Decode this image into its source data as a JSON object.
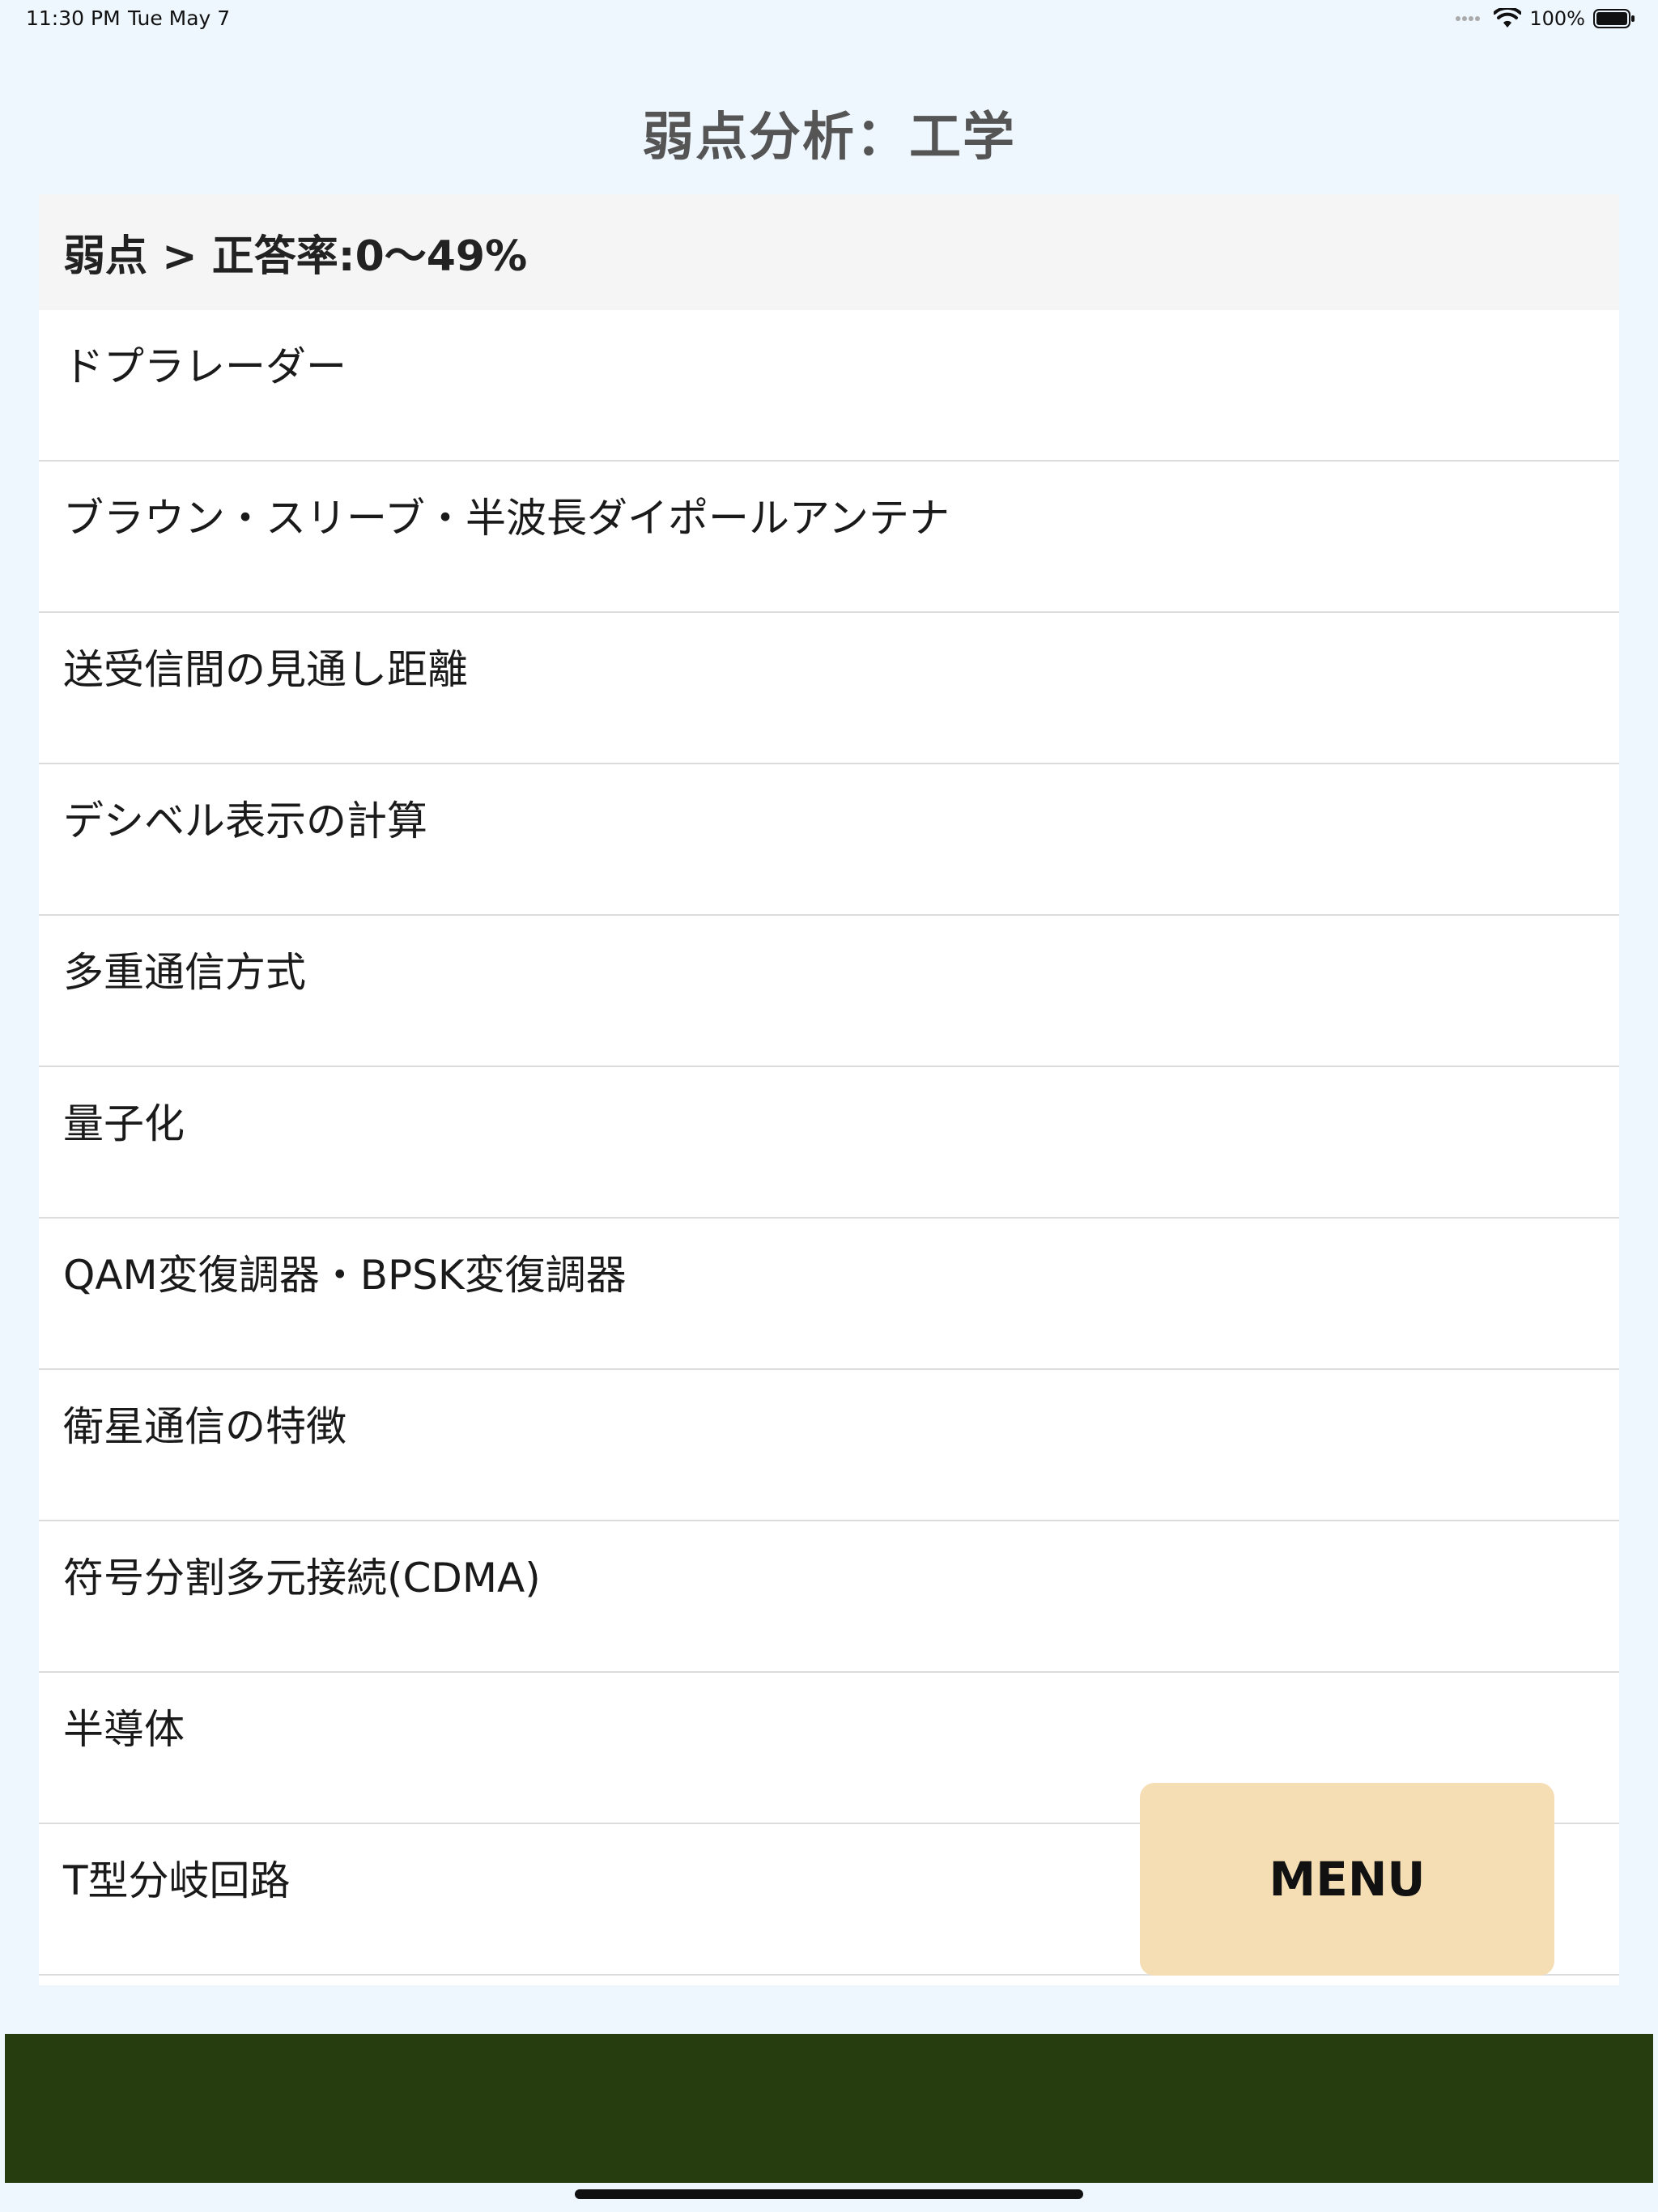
{
  "status_bar": {
    "time": "11:30 PM",
    "date": "Tue May 7",
    "battery_percent": "100%",
    "icons": [
      "signal-dots-icon",
      "wifi-icon",
      "battery-icon"
    ]
  },
  "page": {
    "title": "弱点分析：工学"
  },
  "list": {
    "header": "弱点 > 正答率:0〜49%",
    "items": [
      "ドプラレーダー",
      "ブラウン・スリーブ・半波長ダイポールアンテナ",
      "送受信間の見通し距離",
      "デシベル表示の計算",
      "多重通信方式",
      "量子化",
      "QAM変復調器・BPSK変復調器",
      "衛星通信の特徴",
      "符号分割多元接続(CDMA)",
      "半導体",
      "T型分岐回路"
    ]
  },
  "menu_button": {
    "label": "MENU"
  },
  "colors": {
    "background": "#eef6fe",
    "menu_button": "#f5deb3",
    "banner": "#263d10"
  }
}
